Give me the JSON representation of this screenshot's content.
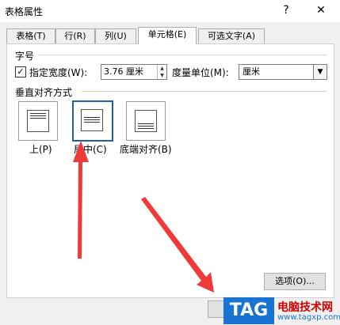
{
  "window": {
    "title": "表格属性",
    "help": "?",
    "close": "✕"
  },
  "tabs": [
    {
      "label": "表格(T)"
    },
    {
      "label": "行(R)"
    },
    {
      "label": "列(U)"
    },
    {
      "label": "单元格(E)",
      "active": true
    },
    {
      "label": "可选文字(A)"
    }
  ],
  "size_section": {
    "label": "字号",
    "specify_width_checked": true,
    "specify_width_label": "指定宽度(W):",
    "width_value": "3.76 厘米",
    "unit_label": "度量单位(M):",
    "unit_value": "厘米"
  },
  "valign_section": {
    "label": "垂直对齐方式",
    "options": [
      {
        "label": "上(P)"
      },
      {
        "label": "居中(C)",
        "selected": true
      },
      {
        "label": "底端对齐(B)"
      }
    ]
  },
  "buttons": {
    "options": "选项(O)..."
  },
  "watermark": {
    "tag": "TAG",
    "line1": "电脑技术网",
    "line2": "www.tagxp.com"
  },
  "colors": {
    "annotation_arrow": "#f03a3a",
    "accent": "#1e5fb4"
  }
}
